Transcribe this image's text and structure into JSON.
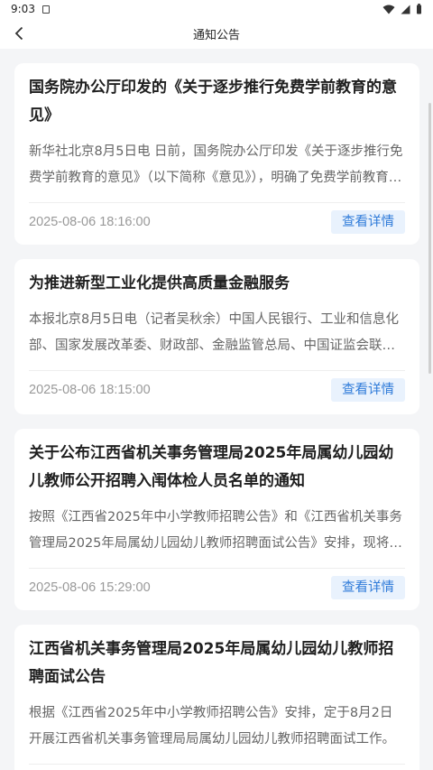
{
  "status": {
    "time": "9:03"
  },
  "nav": {
    "title": "通知公告"
  },
  "notices": [
    {
      "title": "国务院办公厅印发的《关于逐步推行免费学前教育的意见》",
      "summary": "新华社北京8月5日电 日前，国务院办公厅印发《关于逐步推行免费学前教育的意见》（以下简称《意见》），明确了免费学前教育实施范围和主要举措。",
      "date": "2025-08-06 18:16:00",
      "action": "查看详情"
    },
    {
      "title": "为推进新型工业化提供高质量金融服务",
      "summary": "本报北京8月5日电（记者吴秋余）中国人民银行、工业和信息化部、国家发展改革委、财政部、金融监管总局、中国证监会联合印发通知。",
      "date": "2025-08-06 18:15:00",
      "action": "查看详情"
    },
    {
      "title": "关于公布江西省机关事务管理局2025年局属幼儿园幼儿教师公开招聘入闱体检人员名单的通知",
      "summary": "按照《江西省2025年中小学教师招聘公告》和《江西省机关事务管理局2025年局属幼儿园幼儿教师招聘面试公告》安排，现将有关事项通知如下。",
      "date": "2025-08-06 15:29:00",
      "action": "查看详情"
    },
    {
      "title": "江西省机关事务管理局2025年局属幼儿园幼儿教师招聘面试公告",
      "summary": "根据《江西省2025年中小学教师招聘公告》安排，定于8月2日开展江西省机关事务管理局局属幼儿园幼儿教师招聘面试工作。",
      "date": "",
      "action": ""
    }
  ]
}
